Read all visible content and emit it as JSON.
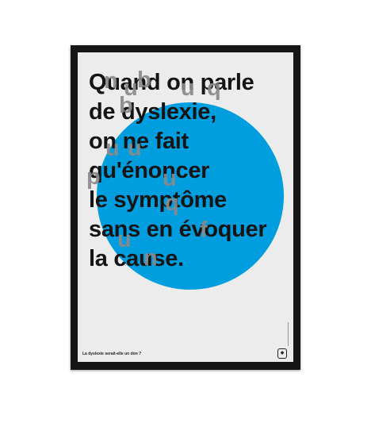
{
  "poster": {
    "lines": [
      "Quand on parle",
      "de dyslexie,",
      "on ne fait",
      "qu'énoncer",
      "le symptôme",
      "sans en évoquer",
      "la cause."
    ],
    "caption": "La dyslexie serait-elle un don ?",
    "overlay_letters": [
      "n",
      "u",
      "b",
      "u",
      "q",
      "b",
      "u",
      "u",
      "p",
      "u",
      "q",
      "f",
      "u",
      "n"
    ],
    "colors": {
      "circle": "#009ddf",
      "text": "#141414",
      "overlay": "#8a8a8a",
      "paper": "#ececec",
      "frame": "#161616"
    }
  }
}
